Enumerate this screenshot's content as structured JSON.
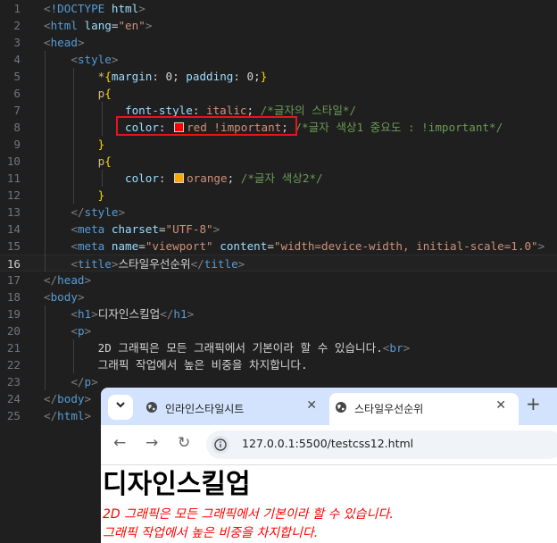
{
  "editor": {
    "lines": [
      {
        "n": "1",
        "tokens": [
          {
            "t": "br",
            "v": "<"
          },
          {
            "t": "tag",
            "v": "!DOCTYPE"
          },
          {
            "t": "text",
            "v": " "
          },
          {
            "t": "attr",
            "v": "html"
          },
          {
            "t": "br",
            "v": ">"
          }
        ]
      },
      {
        "n": "2",
        "tokens": [
          {
            "t": "br",
            "v": "<"
          },
          {
            "t": "tag",
            "v": "html"
          },
          {
            "t": "text",
            "v": " "
          },
          {
            "t": "attr",
            "v": "lang"
          },
          {
            "t": "text",
            "v": "="
          },
          {
            "t": "val",
            "v": "\"en\""
          },
          {
            "t": "br",
            "v": ">"
          }
        ]
      },
      {
        "n": "3",
        "tokens": [
          {
            "t": "br",
            "v": "<"
          },
          {
            "t": "tag",
            "v": "head"
          },
          {
            "t": "br",
            "v": ">"
          }
        ]
      },
      {
        "n": "4",
        "tokens": [
          {
            "t": "text",
            "v": "    "
          },
          {
            "t": "br",
            "v": "<"
          },
          {
            "t": "tag",
            "v": "style"
          },
          {
            "t": "br",
            "v": ">"
          }
        ]
      },
      {
        "n": "5",
        "tokens": [
          {
            "t": "text",
            "v": "        "
          },
          {
            "t": "sel",
            "v": "*"
          },
          {
            "t": "brace",
            "v": "{"
          },
          {
            "t": "attr",
            "v": "margin"
          },
          {
            "t": "text",
            "v": ": 0; "
          },
          {
            "t": "attr",
            "v": "padding"
          },
          {
            "t": "text",
            "v": ": 0;"
          },
          {
            "t": "brace",
            "v": "}"
          }
        ]
      },
      {
        "n": "6",
        "tokens": [
          {
            "t": "text",
            "v": "        "
          },
          {
            "t": "sel",
            "v": "p"
          },
          {
            "t": "brace",
            "v": "{"
          }
        ]
      },
      {
        "n": "7",
        "tokens": [
          {
            "t": "text",
            "v": "            "
          },
          {
            "t": "attr",
            "v": "font-style"
          },
          {
            "t": "text",
            "v": ": "
          },
          {
            "t": "val",
            "v": "italic"
          },
          {
            "t": "text",
            "v": "; "
          },
          {
            "t": "cmt",
            "v": "/*글자의 스타일*/"
          }
        ]
      },
      {
        "n": "8",
        "tokens": [
          {
            "t": "text",
            "v": "            "
          },
          {
            "t": "attr",
            "v": "color"
          },
          {
            "t": "text",
            "v": ": "
          },
          {
            "t": "swatch",
            "v": "#ff0000"
          },
          {
            "t": "val",
            "v": "red !important"
          },
          {
            "t": "text",
            "v": "; "
          },
          {
            "t": "cmt",
            "v": "/*글자 색상1 중요도 : !important*/"
          }
        ]
      },
      {
        "n": "9",
        "tokens": [
          {
            "t": "text",
            "v": "        "
          },
          {
            "t": "brace",
            "v": "}"
          }
        ]
      },
      {
        "n": "10",
        "tokens": [
          {
            "t": "text",
            "v": "        "
          },
          {
            "t": "sel",
            "v": "p"
          },
          {
            "t": "brace",
            "v": "{"
          }
        ]
      },
      {
        "n": "11",
        "tokens": [
          {
            "t": "text",
            "v": "            "
          },
          {
            "t": "attr",
            "v": "color"
          },
          {
            "t": "text",
            "v": ": "
          },
          {
            "t": "swatch",
            "v": "#ffa500"
          },
          {
            "t": "val",
            "v": "orange"
          },
          {
            "t": "text",
            "v": "; "
          },
          {
            "t": "cmt",
            "v": "/*글자 색상2*/"
          }
        ]
      },
      {
        "n": "12",
        "tokens": [
          {
            "t": "text",
            "v": "        "
          },
          {
            "t": "brace",
            "v": "}"
          }
        ]
      },
      {
        "n": "13",
        "tokens": [
          {
            "t": "text",
            "v": "    "
          },
          {
            "t": "br",
            "v": "</"
          },
          {
            "t": "tag",
            "v": "style"
          },
          {
            "t": "br",
            "v": ">"
          }
        ]
      },
      {
        "n": "14",
        "tokens": [
          {
            "t": "text",
            "v": "    "
          },
          {
            "t": "br",
            "v": "<"
          },
          {
            "t": "tag",
            "v": "meta"
          },
          {
            "t": "text",
            "v": " "
          },
          {
            "t": "attr",
            "v": "charset"
          },
          {
            "t": "text",
            "v": "="
          },
          {
            "t": "val",
            "v": "\"UTF-8\""
          },
          {
            "t": "br",
            "v": ">"
          }
        ]
      },
      {
        "n": "15",
        "tokens": [
          {
            "t": "text",
            "v": "    "
          },
          {
            "t": "br",
            "v": "<"
          },
          {
            "t": "tag",
            "v": "meta"
          },
          {
            "t": "text",
            "v": " "
          },
          {
            "t": "attr",
            "v": "name"
          },
          {
            "t": "text",
            "v": "="
          },
          {
            "t": "val",
            "v": "\"viewport\""
          },
          {
            "t": "text",
            "v": " "
          },
          {
            "t": "attr",
            "v": "content"
          },
          {
            "t": "text",
            "v": "="
          },
          {
            "t": "val",
            "v": "\"width=device-width, initial-scale=1.0\""
          },
          {
            "t": "br",
            "v": ">"
          }
        ]
      },
      {
        "n": "16",
        "tokens": [
          {
            "t": "text",
            "v": "    "
          },
          {
            "t": "br",
            "v": "<"
          },
          {
            "t": "tag",
            "v": "title"
          },
          {
            "t": "br",
            "v": ">"
          },
          {
            "t": "text",
            "v": "스타일우선순위"
          },
          {
            "t": "br",
            "v": "</"
          },
          {
            "t": "tag",
            "v": "title"
          },
          {
            "t": "br",
            "v": ">"
          }
        ]
      },
      {
        "n": "17",
        "tokens": [
          {
            "t": "br",
            "v": "</"
          },
          {
            "t": "tag",
            "v": "head"
          },
          {
            "t": "br",
            "v": ">"
          }
        ]
      },
      {
        "n": "18",
        "tokens": [
          {
            "t": "br",
            "v": "<"
          },
          {
            "t": "tag",
            "v": "body"
          },
          {
            "t": "br",
            "v": ">"
          }
        ]
      },
      {
        "n": "19",
        "tokens": [
          {
            "t": "text",
            "v": "    "
          },
          {
            "t": "br",
            "v": "<"
          },
          {
            "t": "tag",
            "v": "h1"
          },
          {
            "t": "br",
            "v": ">"
          },
          {
            "t": "text",
            "v": "디자인스킬업"
          },
          {
            "t": "br",
            "v": "</"
          },
          {
            "t": "tag",
            "v": "h1"
          },
          {
            "t": "br",
            "v": ">"
          }
        ]
      },
      {
        "n": "20",
        "tokens": [
          {
            "t": "text",
            "v": "    "
          },
          {
            "t": "br",
            "v": "<"
          },
          {
            "t": "tag",
            "v": "p"
          },
          {
            "t": "br",
            "v": ">"
          }
        ]
      },
      {
        "n": "21",
        "tokens": [
          {
            "t": "text",
            "v": "        2D 그래픽은 모든 그래픽에서 기본이라 할 수 있습니다."
          },
          {
            "t": "br",
            "v": "<"
          },
          {
            "t": "tag",
            "v": "br"
          },
          {
            "t": "br",
            "v": ">"
          }
        ]
      },
      {
        "n": "22",
        "tokens": [
          {
            "t": "text",
            "v": "        그래픽 작업에서 높은 비중을 차지합니다."
          }
        ]
      },
      {
        "n": "23",
        "tokens": [
          {
            "t": "text",
            "v": "    "
          },
          {
            "t": "br",
            "v": "</"
          },
          {
            "t": "tag",
            "v": "p"
          },
          {
            "t": "br",
            "v": ">"
          }
        ]
      },
      {
        "n": "24",
        "tokens": [
          {
            "t": "br",
            "v": "</"
          },
          {
            "t": "tag",
            "v": "body"
          },
          {
            "t": "br",
            "v": ">"
          }
        ]
      },
      {
        "n": "25",
        "tokens": [
          {
            "t": "br",
            "v": "</"
          },
          {
            "t": "tag",
            "v": "html"
          },
          {
            "t": "br",
            "v": ">"
          }
        ]
      }
    ],
    "current_line": "16"
  },
  "browser": {
    "tabs": [
      {
        "title": "인라인스타일시트",
        "active": false
      },
      {
        "title": "스타일우선순위",
        "active": true
      }
    ],
    "new_tab_label": "+",
    "tab_search_icon": "chevron-down-icon",
    "url": "127.0.0.1:5500/testcss12.html",
    "page": {
      "heading": "디자인스킬업",
      "paragraph_line1": "2D 그래픽은 모든 그래픽에서 기본이라 할 수 있습니다.",
      "paragraph_line2": "그래픽 작업에서 높은 비중을 차지합니다.",
      "text_color": "#ff0000"
    }
  }
}
